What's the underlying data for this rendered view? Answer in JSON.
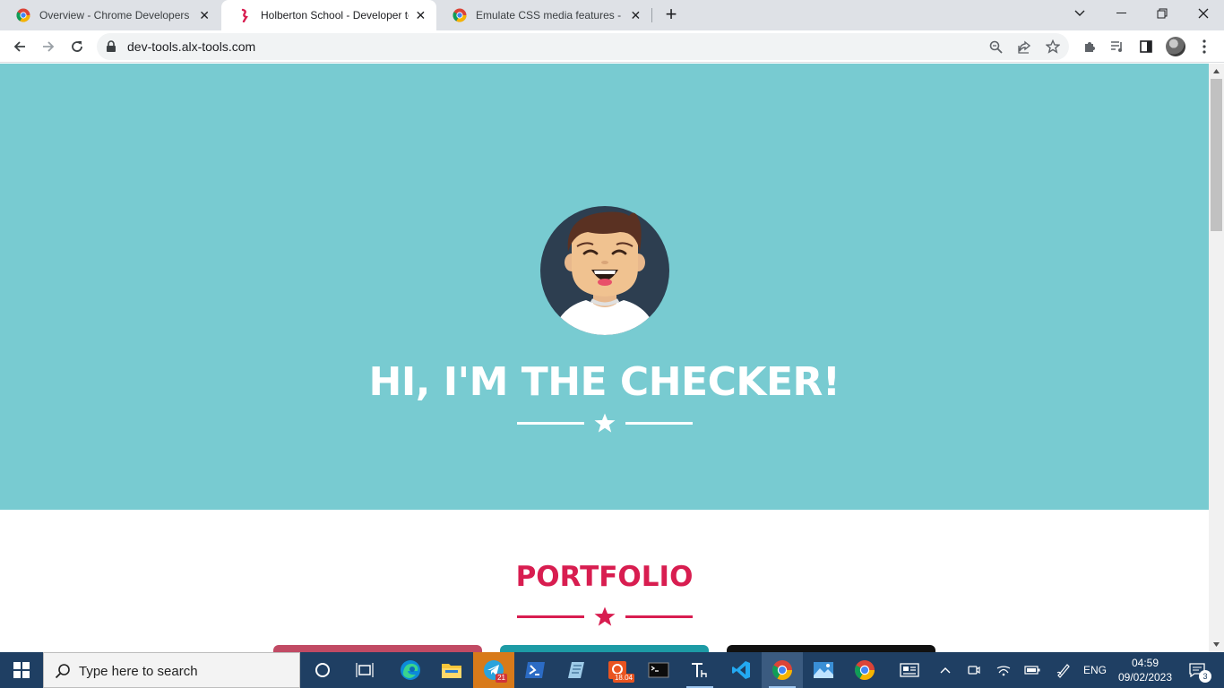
{
  "browser": {
    "tabs": [
      {
        "title": "Overview - Chrome Developers",
        "favicon": "chrome-icon",
        "active": false
      },
      {
        "title": "Holberton School - Developer tools",
        "favicon": "holberton-icon",
        "active": true
      },
      {
        "title": "Emulate CSS media features - Chrome Developers",
        "favicon": "chrome-icon",
        "active": false
      }
    ],
    "url": "dev-tools.alx-tools.com"
  },
  "page": {
    "hero": {
      "title": "HI, I'M THE CHECKER!",
      "background": "#78cbd1",
      "text_color": "#ffffff"
    },
    "portfolio": {
      "title": "PORTFOLIO",
      "accent": "#d81d50",
      "cards": [
        {
          "color": "#c14a64"
        },
        {
          "color": "#1d9ba5"
        },
        {
          "color": "#111111"
        }
      ]
    }
  },
  "taskbar": {
    "search_placeholder": "Type here to search",
    "telegram_badge": "21",
    "ubuntu_badge": "18.04",
    "language": "ENG",
    "time": "04:59",
    "date": "09/02/2023",
    "notification_count": "3"
  }
}
